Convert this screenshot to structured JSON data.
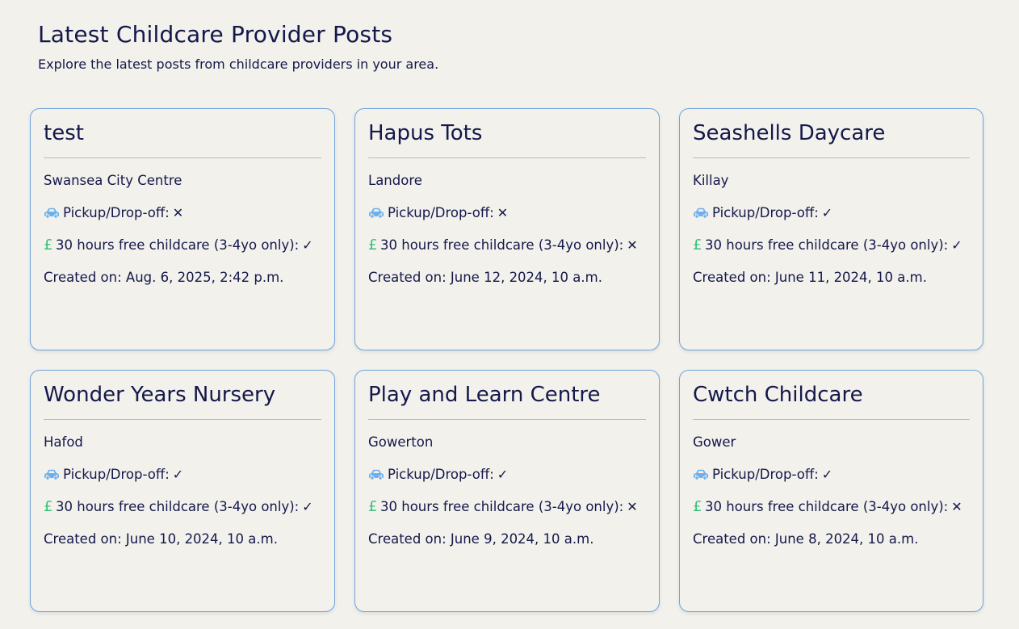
{
  "header": {
    "title": "Latest Childcare Provider Posts",
    "subtitle": "Explore the latest posts from childcare providers in your area."
  },
  "labels": {
    "pickup": "Pickup/Drop-off:",
    "free_hours": "30 hours free childcare (3-4yo only):",
    "pound_symbol": "£",
    "check_symbol": "✓",
    "cross_symbol": "✕"
  },
  "colors": {
    "card_border": "#6fa3dc",
    "car_icon": "#6fb0ec",
    "pound_icon": "#3cc07a",
    "text": "#14184a",
    "background": "#f2f1ec"
  },
  "posts": [
    {
      "name": "test",
      "location": "Swansea City Centre",
      "pickup": false,
      "free_hours": true,
      "created": "Created on: Aug. 6, 2025, 2:42 p.m."
    },
    {
      "name": "Hapus Tots",
      "location": "Landore",
      "pickup": false,
      "free_hours": false,
      "created": "Created on: June 12, 2024, 10 a.m."
    },
    {
      "name": "Seashells Daycare",
      "location": "Killay",
      "pickup": true,
      "free_hours": true,
      "created": "Created on: June 11, 2024, 10 a.m."
    },
    {
      "name": "Wonder Years Nursery",
      "location": "Hafod",
      "pickup": true,
      "free_hours": true,
      "created": "Created on: June 10, 2024, 10 a.m."
    },
    {
      "name": "Play and Learn Centre",
      "location": "Gowerton",
      "pickup": true,
      "free_hours": false,
      "created": "Created on: June 9, 2024, 10 a.m."
    },
    {
      "name": "Cwtch Childcare",
      "location": "Gower",
      "pickup": true,
      "free_hours": false,
      "created": "Created on: June 8, 2024, 10 a.m."
    }
  ]
}
